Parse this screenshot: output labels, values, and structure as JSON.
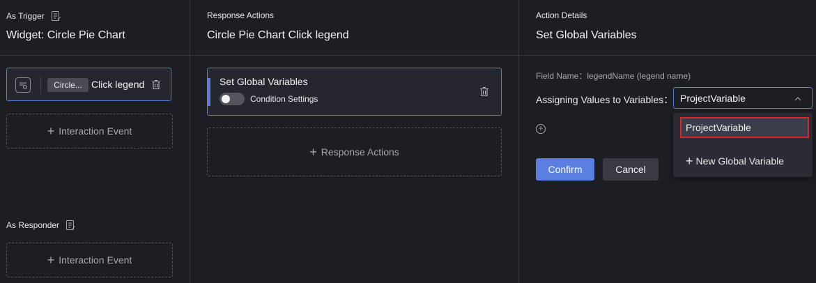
{
  "left": {
    "trigger_label": "As Trigger",
    "widget_title": "Widget: Circle Pie Chart",
    "card": {
      "chip": "Circle...",
      "label": "Click legend"
    },
    "add_event": "Interaction Event",
    "responder_label": "As Responder",
    "add_event_2": "Interaction Event"
  },
  "middle": {
    "section_label": "Response Actions",
    "title": "Circle Pie Chart Click legend",
    "card": {
      "title": "Set Global Variables",
      "condition": "Condition Settings",
      "condition_enabled": false
    },
    "add_action": "Response Actions"
  },
  "right": {
    "section_label": "Action Details",
    "title": "Set Global Variables",
    "field_name": "Field Name：legendName (legend name)",
    "assign_label": "Assigning Values to Variables：",
    "select_value": "ProjectVariable",
    "dropdown": {
      "option": "ProjectVariable",
      "new": "New Global Variable"
    },
    "confirm": "Confirm",
    "cancel": "Cancel"
  },
  "colors": {
    "accent": "#5a7bd6",
    "highlight": "#d7262b",
    "background": "#1d1e24"
  }
}
